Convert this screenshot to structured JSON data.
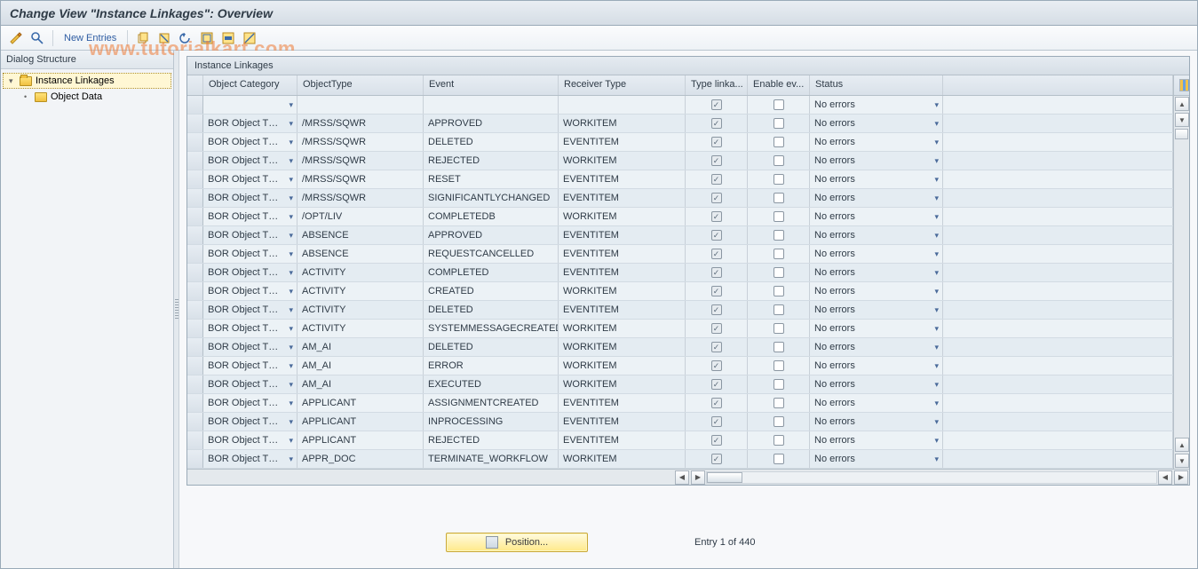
{
  "title": "Change View \"Instance Linkages\": Overview",
  "watermark": "www.tutorialkart.com",
  "toolbar": {
    "new_entries": "New Entries"
  },
  "tree": {
    "header": "Dialog Structure",
    "items": [
      {
        "label": "Instance Linkages",
        "selected": true,
        "expanded": true,
        "level": 0
      },
      {
        "label": "Object Data",
        "selected": false,
        "expanded": false,
        "level": 1
      }
    ]
  },
  "grid": {
    "title": "Instance Linkages",
    "columns": {
      "category": "Object Category",
      "otype": "ObjectType",
      "event": "Event",
      "recv": "Receiver Type",
      "tlink": "Type linka...",
      "enev": "Enable ev...",
      "status": "Status"
    },
    "status_default": "No errors",
    "rows": [
      {
        "cat": "",
        "otype": "",
        "event": "",
        "recv": "",
        "tl": true,
        "ee": false,
        "stat": "No errors"
      },
      {
        "cat": "BOR Object T…",
        "otype": "/MRSS/SQWR",
        "event": "APPROVED",
        "recv": "WORKITEM",
        "tl": true,
        "ee": false,
        "stat": "No errors"
      },
      {
        "cat": "BOR Object T…",
        "otype": "/MRSS/SQWR",
        "event": "DELETED",
        "recv": "EVENTITEM",
        "tl": true,
        "ee": false,
        "stat": "No errors"
      },
      {
        "cat": "BOR Object T…",
        "otype": "/MRSS/SQWR",
        "event": "REJECTED",
        "recv": "WORKITEM",
        "tl": true,
        "ee": false,
        "stat": "No errors"
      },
      {
        "cat": "BOR Object T…",
        "otype": "/MRSS/SQWR",
        "event": "RESET",
        "recv": "EVENTITEM",
        "tl": true,
        "ee": false,
        "stat": "No errors"
      },
      {
        "cat": "BOR Object T…",
        "otype": "/MRSS/SQWR",
        "event": "SIGNIFICANTLYCHANGED",
        "recv": "EVENTITEM",
        "tl": true,
        "ee": false,
        "stat": "No errors"
      },
      {
        "cat": "BOR Object T…",
        "otype": "/OPT/LIV",
        "event": "COMPLETEDB",
        "recv": "WORKITEM",
        "tl": true,
        "ee": false,
        "stat": "No errors"
      },
      {
        "cat": "BOR Object T…",
        "otype": "ABSENCE",
        "event": "APPROVED",
        "recv": "EVENTITEM",
        "tl": true,
        "ee": false,
        "stat": "No errors"
      },
      {
        "cat": "BOR Object T…",
        "otype": "ABSENCE",
        "event": "REQUESTCANCELLED",
        "recv": "EVENTITEM",
        "tl": true,
        "ee": false,
        "stat": "No errors"
      },
      {
        "cat": "BOR Object T…",
        "otype": "ACTIVITY",
        "event": "COMPLETED",
        "recv": "EVENTITEM",
        "tl": true,
        "ee": false,
        "stat": "No errors"
      },
      {
        "cat": "BOR Object T…",
        "otype": "ACTIVITY",
        "event": "CREATED",
        "recv": "WORKITEM",
        "tl": true,
        "ee": false,
        "stat": "No errors"
      },
      {
        "cat": "BOR Object T…",
        "otype": "ACTIVITY",
        "event": "DELETED",
        "recv": "EVENTITEM",
        "tl": true,
        "ee": false,
        "stat": "No errors"
      },
      {
        "cat": "BOR Object T…",
        "otype": "ACTIVITY",
        "event": "SYSTEMMESSAGECREATED",
        "recv": "WORKITEM",
        "tl": true,
        "ee": false,
        "stat": "No errors"
      },
      {
        "cat": "BOR Object T…",
        "otype": "AM_AI",
        "event": "DELETED",
        "recv": "WORKITEM",
        "tl": true,
        "ee": false,
        "stat": "No errors"
      },
      {
        "cat": "BOR Object T…",
        "otype": "AM_AI",
        "event": "ERROR",
        "recv": "WORKITEM",
        "tl": true,
        "ee": false,
        "stat": "No errors"
      },
      {
        "cat": "BOR Object T…",
        "otype": "AM_AI",
        "event": "EXECUTED",
        "recv": "WORKITEM",
        "tl": true,
        "ee": false,
        "stat": "No errors"
      },
      {
        "cat": "BOR Object T…",
        "otype": "APPLICANT",
        "event": "ASSIGNMENTCREATED",
        "recv": "EVENTITEM",
        "tl": true,
        "ee": false,
        "stat": "No errors"
      },
      {
        "cat": "BOR Object T…",
        "otype": "APPLICANT",
        "event": "INPROCESSING",
        "recv": "EVENTITEM",
        "tl": true,
        "ee": false,
        "stat": "No errors"
      },
      {
        "cat": "BOR Object T…",
        "otype": "APPLICANT",
        "event": "REJECTED",
        "recv": "EVENTITEM",
        "tl": true,
        "ee": false,
        "stat": "No errors"
      },
      {
        "cat": "BOR Object T…",
        "otype": "APPR_DOC",
        "event": "TERMINATE_WORKFLOW",
        "recv": "WORKITEM",
        "tl": true,
        "ee": false,
        "stat": "No errors"
      }
    ]
  },
  "footer": {
    "position_btn": "Position...",
    "entry_label": "Entry 1 of 440"
  }
}
